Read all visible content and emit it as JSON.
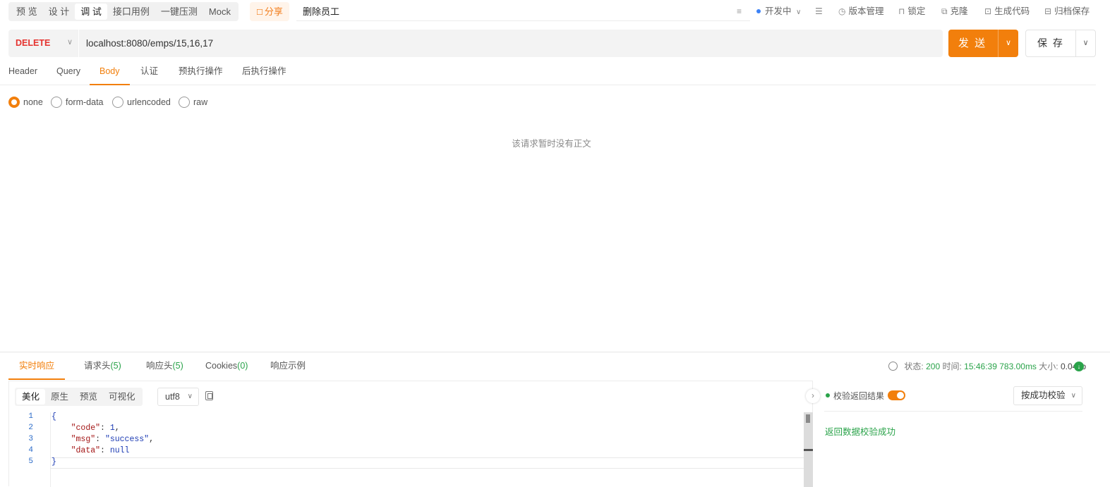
{
  "mode_tabs": [
    "预 览",
    "设 计",
    "调 试",
    "接口用例",
    "一键压测",
    "Mock"
  ],
  "share_label": "分享",
  "api_name": "删除员工",
  "top_actions": {
    "env": "开发中",
    "version": "版本管理",
    "lock": "锁定",
    "clone": "克隆",
    "gen_code": "生成代码",
    "archive": "归档保存"
  },
  "request": {
    "method": "DELETE",
    "url": "localhost:8080/emps/15,16,17",
    "send_label": "发 送",
    "save_label": "保 存"
  },
  "request_tabs": [
    "Header",
    "Query",
    "Body",
    "认证",
    "预执行操作",
    "后执行操作"
  ],
  "body_types": [
    "none",
    "form-data",
    "urlencoded",
    "raw"
  ],
  "empty_body_text": "该请求暂时没有正文",
  "response_tabs": {
    "realtime": "实时响应",
    "req_headers": "请求头",
    "req_headers_count": "(5)",
    "resp_headers": "响应头",
    "resp_headers_count": "(5)",
    "cookies": "Cookies",
    "cookies_count": "(0)",
    "example": "响应示例"
  },
  "response_meta": {
    "status_label": "状态:",
    "status": "200",
    "time_label": "时间:",
    "time": "15:46:39",
    "duration": "783.00ms",
    "size_label": "大小:",
    "size": "0.04kb"
  },
  "format_tabs": [
    "美化",
    "原生",
    "预览",
    "可视化"
  ],
  "charset": "utf8",
  "code_lines": [
    "1",
    "2",
    "3",
    "4",
    "5"
  ],
  "response_body": {
    "open": "{",
    "code_key": "\"code\"",
    "code_val": "1",
    "msg_key": "\"msg\"",
    "msg_val": "\"success\"",
    "data_key": "\"data\"",
    "data_val": "null",
    "close": "}"
  },
  "validation": {
    "label": "校验返回结果",
    "mode": "按成功校验",
    "result": "返回数据校验成功"
  },
  "colors": {
    "accent": "#f27f0c",
    "method_delete": "#e5332f",
    "success": "#2aa34a"
  }
}
